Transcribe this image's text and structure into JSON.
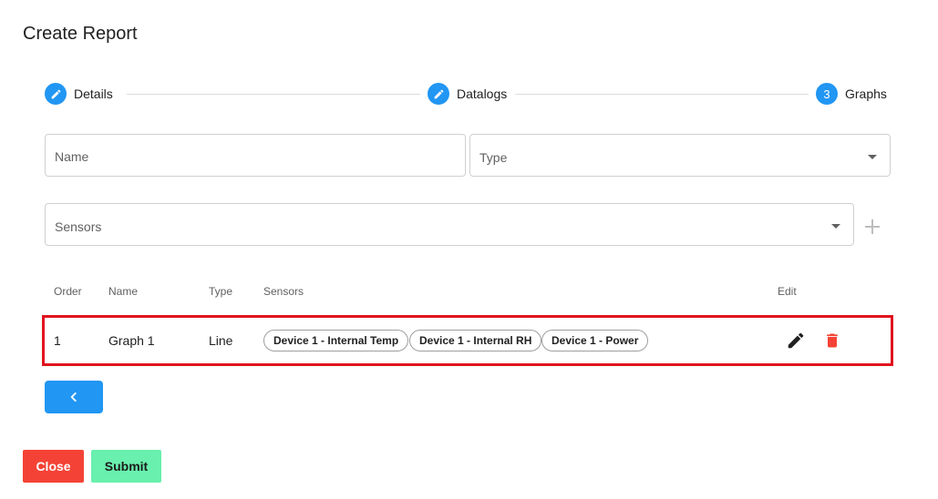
{
  "dialog": {
    "title": "Create Report"
  },
  "stepper": {
    "steps": [
      {
        "label": "Details",
        "icon": "pencil-icon",
        "state": "completed"
      },
      {
        "label": "Datalogs",
        "icon": "pencil-icon",
        "state": "completed"
      },
      {
        "label": "Graphs",
        "number": "3",
        "state": "active"
      }
    ]
  },
  "form": {
    "name_label": "Name",
    "type_label": "Type",
    "sensors_label": "Sensors"
  },
  "table": {
    "headers": [
      "Order",
      "Name",
      "Type",
      "Sensors",
      "Edit"
    ],
    "rows": [
      {
        "order": "1",
        "name": "Graph 1",
        "type": "Line",
        "sensors": [
          "Device 1 - Internal Temp",
          "Device 1 - Internal RH",
          "Device 1 - Power"
        ]
      }
    ]
  },
  "buttons": {
    "close": "Close",
    "submit": "Submit"
  },
  "colors": {
    "primary": "#2196f3",
    "danger": "#f44336",
    "success": "#69f0ae",
    "highlight": "#e0141e"
  }
}
